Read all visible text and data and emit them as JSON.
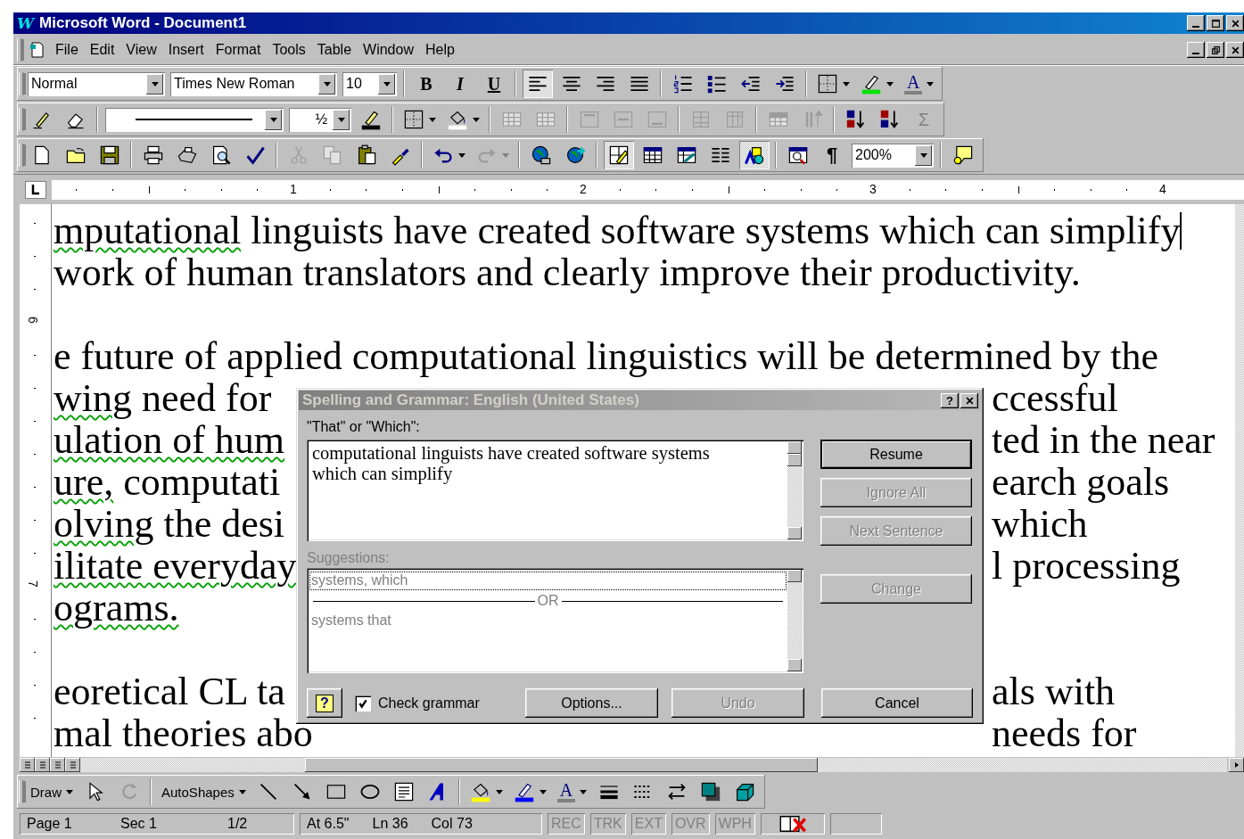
{
  "window": {
    "app_icon": "W",
    "title": "Microsoft Word - Document1"
  },
  "menu": [
    {
      "label": "File"
    },
    {
      "label": "Edit"
    },
    {
      "label": "View"
    },
    {
      "label": "Insert"
    },
    {
      "label": "Format"
    },
    {
      "label": "Tools"
    },
    {
      "label": "Table"
    },
    {
      "label": "Window"
    },
    {
      "label": "Help"
    }
  ],
  "toolbars": [
    {
      "items": [
        {
          "kind": "style-combo",
          "value": "Normal"
        },
        {
          "kind": "font-combo",
          "value": "Times New Roman"
        },
        {
          "kind": "size-combo",
          "value": "10"
        },
        {
          "kind": "separator"
        },
        {
          "kind": "bold",
          "label": "B",
          "disabled": false,
          "pressed": false,
          "menu": false
        },
        {
          "kind": "italic",
          "label": "I",
          "disabled": false,
          "pressed": false,
          "menu": false
        },
        {
          "kind": "underline",
          "label": "U",
          "disabled": false,
          "pressed": false,
          "menu": false
        },
        {
          "kind": "separator"
        },
        {
          "kind": "align-left",
          "disabled": false,
          "pressed": true,
          "menu": false
        },
        {
          "kind": "align-center",
          "disabled": false,
          "pressed": false,
          "menu": false
        },
        {
          "kind": "align-right",
          "disabled": false,
          "pressed": false,
          "menu": false
        },
        {
          "kind": "justify",
          "disabled": false,
          "pressed": false,
          "menu": false
        },
        {
          "kind": "separator"
        },
        {
          "kind": "numbering",
          "disabled": false,
          "pressed": false,
          "menu": false
        },
        {
          "kind": "bullets",
          "disabled": false,
          "pressed": false,
          "menu": false
        },
        {
          "kind": "outdent",
          "disabled": false,
          "pressed": false,
          "menu": false
        },
        {
          "kind": "indent",
          "disabled": false,
          "pressed": false,
          "menu": false
        },
        {
          "kind": "separator"
        },
        {
          "kind": "borders",
          "disabled": false,
          "pressed": false,
          "menu": true
        },
        {
          "kind": "highlight",
          "disabled": false,
          "pressed": false,
          "menu": true
        },
        {
          "kind": "font-color",
          "label": "A",
          "disabled": false,
          "pressed": false,
          "menu": true
        }
      ]
    },
    {
      "items": [
        {
          "kind": "pencil",
          "disabled": false,
          "pressed": false,
          "menu": false
        },
        {
          "kind": "eraser",
          "disabled": false,
          "pressed": false,
          "menu": false
        },
        {
          "kind": "separator"
        },
        {
          "kind": "line-style-combo"
        },
        {
          "kind": "weight-combo",
          "value": "½"
        },
        {
          "kind": "border-color",
          "disabled": false,
          "pressed": false,
          "menu": false
        },
        {
          "kind": "separator"
        },
        {
          "kind": "borders",
          "disabled": false,
          "pressed": false,
          "menu": true
        },
        {
          "kind": "fill",
          "disabled": false,
          "pressed": false,
          "menu": true
        },
        {
          "kind": "separator"
        },
        {
          "kind": "merge-cells",
          "disabled": true,
          "pressed": false,
          "menu": false
        },
        {
          "kind": "split-cells",
          "disabled": true,
          "pressed": false,
          "menu": false
        },
        {
          "kind": "separator"
        },
        {
          "kind": "align-top",
          "disabled": true,
          "pressed": false,
          "menu": false
        },
        {
          "kind": "align-middle",
          "disabled": true,
          "pressed": false,
          "menu": false
        },
        {
          "kind": "align-bottom",
          "disabled": true,
          "pressed": false,
          "menu": false
        },
        {
          "kind": "separator"
        },
        {
          "kind": "distribute-rows",
          "disabled": true,
          "pressed": false,
          "menu": false
        },
        {
          "kind": "distribute-cols",
          "disabled": true,
          "pressed": false,
          "menu": false
        },
        {
          "kind": "separator"
        },
        {
          "kind": "table-autoformat",
          "disabled": true,
          "pressed": false,
          "menu": false
        },
        {
          "kind": "text-direction",
          "disabled": true,
          "pressed": false,
          "menu": false
        },
        {
          "kind": "separator"
        },
        {
          "kind": "sort-asc",
          "disabled": false,
          "pressed": false,
          "menu": false
        },
        {
          "kind": "sort-desc",
          "disabled": false,
          "pressed": false,
          "menu": false
        },
        {
          "kind": "autosum",
          "label": "Σ",
          "disabled": true,
          "pressed": false,
          "menu": false
        }
      ]
    },
    {
      "items": [
        {
          "kind": "new",
          "disabled": false,
          "pressed": false,
          "menu": false
        },
        {
          "kind": "open",
          "disabled": false,
          "pressed": false,
          "menu": false
        },
        {
          "kind": "save",
          "disabled": false,
          "pressed": false,
          "menu": false
        },
        {
          "kind": "separator"
        },
        {
          "kind": "print",
          "disabled": false,
          "pressed": false,
          "menu": false
        },
        {
          "kind": "fax",
          "disabled": false,
          "pressed": false,
          "menu": false
        },
        {
          "kind": "print-preview",
          "disabled": false,
          "pressed": false,
          "menu": false
        },
        {
          "kind": "spelling",
          "disabled": false,
          "pressed": false,
          "menu": false
        },
        {
          "kind": "separator"
        },
        {
          "kind": "cut",
          "disabled": true,
          "pressed": false,
          "menu": false
        },
        {
          "kind": "copy",
          "disabled": true,
          "pressed": false,
          "menu": false
        },
        {
          "kind": "paste",
          "disabled": false,
          "pressed": false,
          "menu": false
        },
        {
          "kind": "format-painter",
          "disabled": false,
          "pressed": false,
          "menu": false
        },
        {
          "kind": "separator"
        },
        {
          "kind": "undo",
          "disabled": false,
          "pressed": false,
          "menu": true
        },
        {
          "kind": "redo",
          "disabled": true,
          "pressed": false,
          "menu": true
        },
        {
          "kind": "separator"
        },
        {
          "kind": "hyperlink",
          "disabled": false,
          "pressed": false,
          "menu": false
        },
        {
          "kind": "web",
          "disabled": false,
          "pressed": false,
          "menu": false
        },
        {
          "kind": "separator"
        },
        {
          "kind": "tables-borders",
          "disabled": false,
          "pressed": true,
          "menu": false
        },
        {
          "kind": "insert-table",
          "disabled": false,
          "pressed": false,
          "menu": false
        },
        {
          "kind": "insert-sheet",
          "disabled": false,
          "pressed": false,
          "menu": false
        },
        {
          "kind": "columns",
          "disabled": false,
          "pressed": false,
          "menu": false
        },
        {
          "kind": "drawing",
          "disabled": false,
          "pressed": true,
          "menu": false
        },
        {
          "kind": "separator"
        },
        {
          "kind": "document-map",
          "disabled": false,
          "pressed": false,
          "menu": false
        },
        {
          "kind": "show-hide",
          "label": "¶",
          "disabled": false,
          "pressed": false,
          "menu": false
        },
        {
          "kind": "zoom-combo",
          "value": "200%"
        },
        {
          "kind": "separator"
        },
        {
          "kind": "assistant",
          "disabled": false,
          "pressed": false,
          "menu": false
        }
      ]
    }
  ],
  "ruler": {
    "numbers": [
      "1",
      "2",
      "3",
      "4"
    ],
    "vertical_numbers": [
      "6",
      "7"
    ]
  },
  "document": {
    "lines": [
      {
        "kind": "text",
        "left": [
          {
            "text": "mputational",
            "flagged": true
          },
          {
            "text": " linguists have created software systems which can simplify",
            "flagged": false
          }
        ],
        "cursor": true
      },
      {
        "kind": "text",
        "left": [
          {
            "text": "work of human translators and clearly improve their productivity.",
            "flagged": false
          }
        ],
        "cursor": false
      },
      {
        "kind": "blank"
      },
      {
        "kind": "text",
        "left": [
          {
            "text": "e future of applied computational linguistics will be determined by the",
            "flagged": false
          }
        ],
        "cursor": false
      },
      {
        "kind": "text",
        "left": [
          {
            "text": "wing",
            "flagged": true
          },
          {
            "text": " need for",
            "flagged": false
          }
        ],
        "right": "ccessful",
        "cursor": false
      },
      {
        "kind": "text",
        "left": [
          {
            "text": "ulation of hum",
            "flagged": true
          }
        ],
        "right": "ted in the near",
        "cursor": false
      },
      {
        "kind": "text",
        "left": [
          {
            "text": "ure,",
            "flagged": true
          },
          {
            "text": " computati",
            "flagged": false
          }
        ],
        "right": "earch goals",
        "cursor": false
      },
      {
        "kind": "text",
        "left": [
          {
            "text": "olving",
            "flagged": true
          },
          {
            "text": " the desi",
            "flagged": false
          }
        ],
        "right": "which",
        "cursor": false
      },
      {
        "kind": "text",
        "left": [
          {
            "text": "ilitate everyday",
            "flagged": true
          }
        ],
        "right": "l processing",
        "cursor": false
      },
      {
        "kind": "text",
        "left": [
          {
            "text": "ograms.",
            "flagged": true
          }
        ],
        "cursor": false
      },
      {
        "kind": "blank"
      },
      {
        "kind": "text",
        "left": [
          {
            "text": "eoretical CL ta",
            "flagged": false
          }
        ],
        "right": "als with",
        "cursor": false
      },
      {
        "kind": "text",
        "left": [
          {
            "text": "mal theories abo",
            "flagged": false
          }
        ],
        "right": "needs for",
        "cursor": false
      }
    ]
  },
  "dialog": {
    "title": "Spelling and Grammar: English (United States)",
    "help_button": "?",
    "issue_label": "\"That\" or \"Which\":",
    "sentence": "computational linguists have created software systems which can simplify",
    "side_buttons": [
      {
        "label": "Resume",
        "disabled": false,
        "default": true
      },
      {
        "label": "Ignore All",
        "disabled": true,
        "default": false
      },
      {
        "label": "Next Sentence",
        "disabled": true,
        "default": false
      }
    ],
    "suggestions_label": "Suggestions:",
    "suggestions_disabled": true,
    "suggestions": [
      {
        "kind": "option",
        "text": "systems, which",
        "selected": true
      },
      {
        "kind": "separator",
        "text": "OR"
      },
      {
        "kind": "option",
        "text": "systems that",
        "selected": false
      }
    ],
    "change_button": {
      "label": "Change",
      "disabled": true,
      "default": false
    },
    "assistant_button": "?",
    "check_grammar": {
      "label": "Check grammar",
      "checked": true
    },
    "bottom_buttons": [
      {
        "label": "Options...",
        "disabled": false,
        "default": false
      },
      {
        "label": "Undo",
        "disabled": true,
        "default": false
      },
      {
        "label": "Cancel",
        "disabled": false,
        "default": false
      }
    ]
  },
  "drawing_toolbar": [
    {
      "kind": "draw-menu",
      "label": "Draw",
      "disabled": false,
      "pressed": false,
      "menu": true
    },
    {
      "kind": "pointer",
      "disabled": false,
      "pressed": false,
      "menu": false
    },
    {
      "kind": "rotate",
      "disabled": true,
      "pressed": false,
      "menu": false
    },
    {
      "kind": "separator"
    },
    {
      "kind": "autoshapes",
      "label": "AutoShapes",
      "disabled": false,
      "pressed": false,
      "menu": true
    },
    {
      "kind": "line",
      "disabled": false,
      "pressed": false,
      "menu": false
    },
    {
      "kind": "arrow",
      "disabled": false,
      "pressed": false,
      "menu": false
    },
    {
      "kind": "rectangle",
      "disabled": false,
      "pressed": false,
      "menu": false
    },
    {
      "kind": "oval",
      "disabled": false,
      "pressed": false,
      "menu": false
    },
    {
      "kind": "textbox",
      "disabled": false,
      "pressed": false,
      "menu": false
    },
    {
      "kind": "wordart",
      "disabled": false,
      "pressed": false,
      "menu": false
    },
    {
      "kind": "separator"
    },
    {
      "kind": "fill-color",
      "disabled": false,
      "pressed": false,
      "menu": true
    },
    {
      "kind": "line-color",
      "disabled": false,
      "pressed": false,
      "menu": true
    },
    {
      "kind": "font-color",
      "label": "A",
      "disabled": false,
      "pressed": false,
      "menu": true
    },
    {
      "kind": "line-style",
      "disabled": false,
      "pressed": false,
      "menu": false
    },
    {
      "kind": "dash-style",
      "disabled": false,
      "pressed": false,
      "menu": false
    },
    {
      "kind": "arrow-style",
      "disabled": false,
      "pressed": false,
      "menu": false
    },
    {
      "kind": "shadow",
      "disabled": false,
      "pressed": false,
      "menu": false
    },
    {
      "kind": "extrusion",
      "disabled": false,
      "pressed": false,
      "menu": false
    }
  ],
  "status_bar": {
    "position": [
      "Page 1",
      "Sec 1",
      "1/2"
    ],
    "location": [
      "At 6.5\"",
      "Ln 36",
      "Col 73"
    ],
    "modes": [
      {
        "label": "REC",
        "active": false
      },
      {
        "label": "TRK",
        "active": false
      },
      {
        "label": "EXT",
        "active": false
      },
      {
        "label": "OVR",
        "active": false
      },
      {
        "label": "WPH",
        "active": false
      }
    ]
  }
}
